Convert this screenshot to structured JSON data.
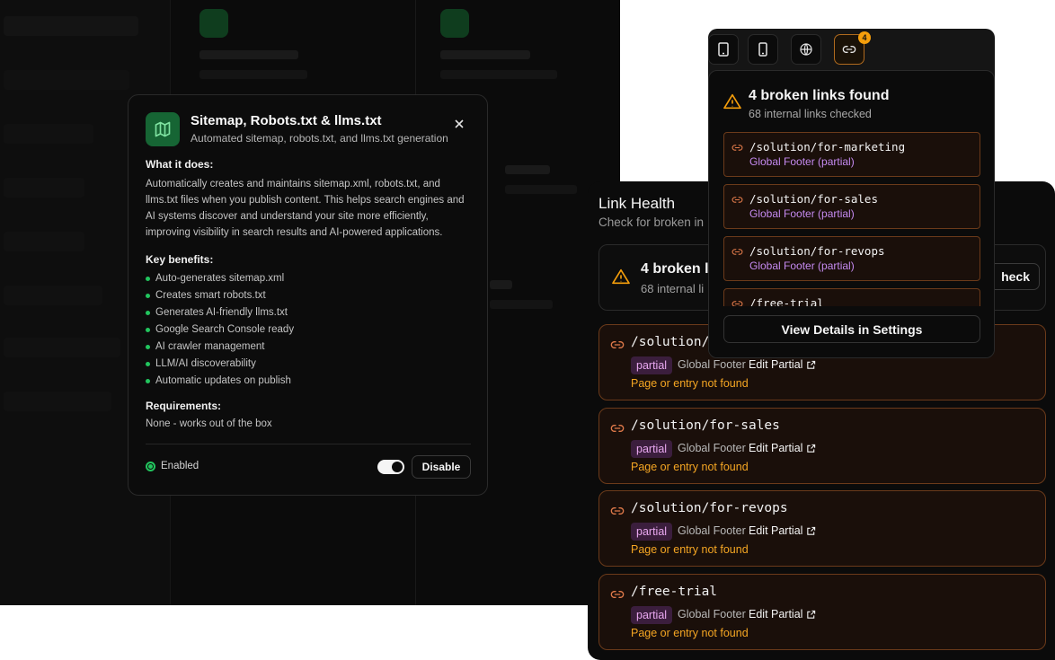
{
  "module": {
    "title": "Sitemap, Robots.txt & llms.txt",
    "subtitle": "Automated sitemap, robots.txt, and llms.txt generation",
    "icon": "map-icon",
    "what_heading": "What it does:",
    "what_text": "Automatically creates and maintains sitemap.xml, robots.txt, and llms.txt files when you publish content. This helps search engines and AI systems discover and understand your site more efficiently, improving visibility in search results and AI-powered applications.",
    "benefits_heading": "Key benefits:",
    "benefits": [
      "Auto-generates sitemap.xml",
      "Creates smart robots.txt",
      "Generates AI-friendly llms.txt",
      "Google Search Console ready",
      "AI crawler management",
      "LLM/AI discoverability",
      "Automatic updates on publish"
    ],
    "requirements_heading": "Requirements:",
    "requirements_text": "None - works out of the box",
    "status": "Enabled",
    "disable_label": "Disable",
    "accent_color": "#22c55e"
  },
  "link_health": {
    "title": "Link Health",
    "subtitle": "Check for broken in",
    "summary_count": "4 broken li",
    "summary_checked": "68 internal li",
    "recheck_label": "heck",
    "items": [
      {
        "path": "/solution/fo",
        "badge": "partial",
        "source": "Global Footer",
        "edit": "Edit Partial",
        "error": "Page or entry not found"
      },
      {
        "path": "/solution/for-sales",
        "badge": "partial",
        "source": "Global Footer",
        "edit": "Edit Partial",
        "error": "Page or entry not found"
      },
      {
        "path": "/solution/for-revops",
        "badge": "partial",
        "source": "Global Footer",
        "edit": "Edit Partial",
        "error": "Page or entry not found"
      },
      {
        "path": "/free-trial",
        "badge": "partial",
        "source": "Global Footer",
        "edit": "Edit Partial",
        "error": "Page or entry not found"
      }
    ],
    "warning_color": "#f5a623"
  },
  "popover": {
    "toolbar": [
      "tablet-icon",
      "mobile-icon",
      "globe-icon",
      "link-icon"
    ],
    "badge_count": "4",
    "count": "4 broken links found",
    "checked": "68 internal links checked",
    "items": [
      {
        "path": "/solution/for-marketing",
        "location": "Global Footer (partial)"
      },
      {
        "path": "/solution/for-sales",
        "location": "Global Footer (partial)"
      },
      {
        "path": "/solution/for-revops",
        "location": "Global Footer (partial)"
      },
      {
        "path": "/free-trial",
        "location": ""
      }
    ],
    "view_label": "View Details in Settings"
  }
}
